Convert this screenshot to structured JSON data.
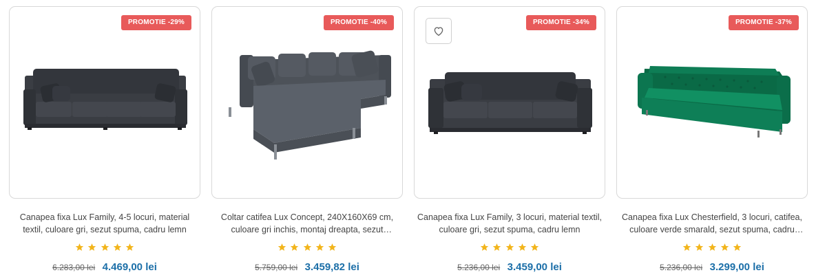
{
  "products": [
    {
      "badge": "PROMOTIE -29%",
      "title": "Canapea fixa Lux Family, 4-5 locuri, material textil, culoare gri, sezut spuma, cadru lemn",
      "rating": 5,
      "old_price": "6.283,00 lei",
      "new_price": "4.469,00 lei",
      "image": "grey-4-seat-sofa",
      "wishlist": false
    },
    {
      "badge": "PROMOTIE -40%",
      "title": "Coltar catifea Lux Concept, 240X160X69 cm, culoare gri inchis, montaj dreapta, sezut spuma,...",
      "rating": 5,
      "old_price": "5.759,00 lei",
      "new_price": "3.459,82 lei",
      "image": "grey-corner-sofa",
      "wishlist": false
    },
    {
      "badge": "PROMOTIE -34%",
      "title": "Canapea fixa Lux Family, 3 locuri, material textil, culoare gri, sezut spuma, cadru lemn",
      "rating": 5,
      "old_price": "5.236,00 lei",
      "new_price": "3.459,00 lei",
      "image": "grey-3-seat-sofa",
      "wishlist": true
    },
    {
      "badge": "PROMOTIE -37%",
      "title": "Canapea fixa Lux Chesterfield, 3 locuri, catifea, culoare verde smarald, sezut spuma, cadru lemn,...",
      "rating": 5,
      "old_price": "5.236,00 lei",
      "new_price": "3.299,00 lei",
      "image": "green-chesterfield-sofa",
      "wishlist": false
    }
  ],
  "colors": {
    "badge": "#e85a5a",
    "price": "#1c6fa8",
    "star": "#f2b51c",
    "sofa_grey": "#3d4046",
    "sofa_green": "#0d7a52"
  },
  "icons": {
    "wishlist": "heart-outline-icon",
    "rating": "star-icon"
  }
}
